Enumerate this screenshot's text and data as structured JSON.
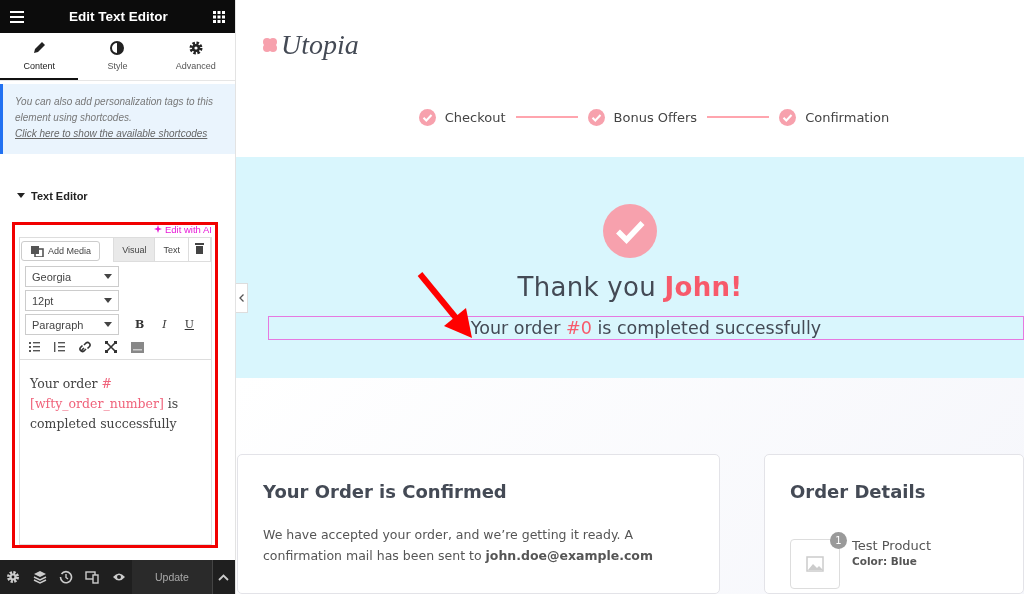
{
  "panel": {
    "title": "Edit Text Editor",
    "tabs": [
      {
        "label": "Content",
        "selected": true
      },
      {
        "label": "Style",
        "selected": false
      },
      {
        "label": "Advanced",
        "selected": false
      }
    ],
    "notice": {
      "text": "You can also add personalization tags to this element using shortcodes.",
      "link": "Click here to show the available shortcodes"
    },
    "section": {
      "title": "Text Editor",
      "expanded": true
    },
    "editor": {
      "ai_link": "Edit with AI",
      "add_media": "Add Media",
      "modes": [
        {
          "label": "Visual",
          "selected": true
        },
        {
          "label": "Text",
          "selected": false
        }
      ],
      "selects": [
        {
          "value": "Georgia"
        },
        {
          "value": "12pt"
        },
        {
          "value": "Paragraph"
        }
      ],
      "format_buttons": [
        "B",
        "I",
        "U"
      ],
      "content": {
        "before": "Your order ",
        "shortcode": "#[wfty_order_number]",
        "after": " is completed successfully"
      }
    },
    "footer": {
      "update": "Update"
    }
  },
  "page": {
    "logo": "Utopia",
    "steps": [
      {
        "label": "Checkout",
        "done": true
      },
      {
        "label": "Bonus Offers",
        "done": true
      },
      {
        "label": "Confirmation",
        "done": true
      }
    ],
    "thanks": {
      "before": "Thank you ",
      "name": "John!"
    },
    "order_line": {
      "before": "Your order ",
      "number": "#0",
      "after": " is completed successfully",
      "selected": true
    },
    "confirmed_card": {
      "title": "Your Order is Confirmed",
      "text": "We have accepted your order, and we’re getting it ready. A confirmation mail has been sent to **john.doe@example.com**"
    },
    "details_card": {
      "title": "Order Details",
      "product": {
        "quantity": "1",
        "name": "Test Product",
        "variant": "Color: Blue"
      }
    }
  }
}
